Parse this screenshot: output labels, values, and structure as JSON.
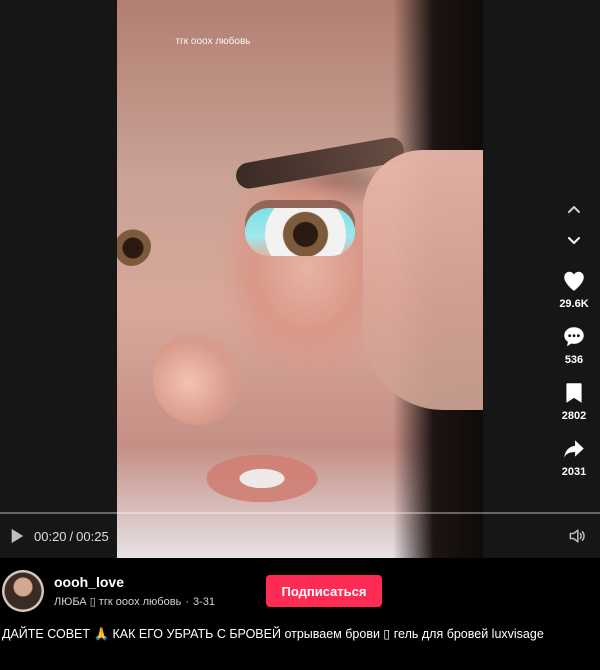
{
  "video": {
    "overlay_text": "тгк ooox любовь",
    "time_current": "00:20",
    "time_separator": "/",
    "time_total": "00:25",
    "progress_fraction": 0.8
  },
  "actions": {
    "likes": "29.6K",
    "comments": "536",
    "saves": "2802",
    "shares": "2031",
    "icons": [
      "chevron-up-icon",
      "chevron-down-icon",
      "heart-icon",
      "comment-icon",
      "bookmark-icon",
      "share-icon",
      "play-icon",
      "volume-icon"
    ]
  },
  "author": {
    "username": "oooh_love",
    "display_line": "ЛЮБА ▯ тгк ooox любовь",
    "date": "3-31",
    "subscribe_label": "Подписаться"
  },
  "description": {
    "text": "ДАЙТЕ СОВЕТ 🙏 КАК ЕГО УБРАТЬ С БРОВЕЙ отрываем брови ▯ гель для бровей luxvisage"
  },
  "colors": {
    "accent": "#fe2c55",
    "background": "#000000",
    "player_bg": "#161616"
  }
}
